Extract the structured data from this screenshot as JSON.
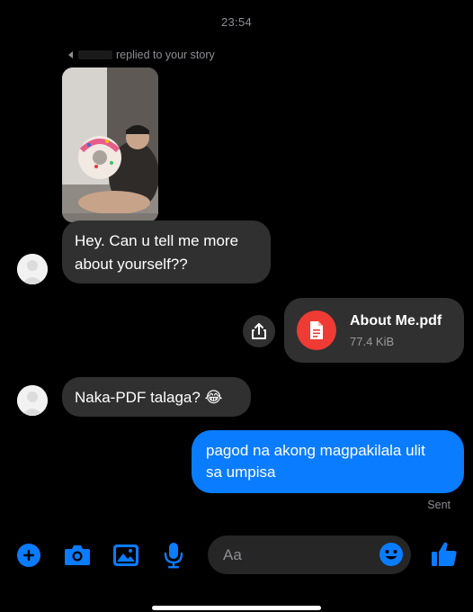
{
  "status": {
    "time": "23:54"
  },
  "story_reply": {
    "text": "replied to your story"
  },
  "messages": {
    "incoming_1": {
      "lines": [
        "Hey. Can u tell me more",
        "about yourself??"
      ]
    },
    "attachment": {
      "file_name": "About Me.pdf",
      "file_size": "77.4 KiB"
    },
    "incoming_2": {
      "text": "Naka-PDF talaga? 😂"
    },
    "outgoing_1": {
      "lines": [
        "pagod na akong magpakilala ulit",
        "sa umpisa"
      ]
    },
    "status_label": "Sent"
  },
  "composer": {
    "placeholder": "Aa",
    "icons": [
      "plus-icon",
      "camera-icon",
      "image-icon",
      "microphone-icon",
      "emoji-icon",
      "thumbs-up-icon"
    ]
  },
  "colors": {
    "accent": "#0a7cff",
    "incoming_bubble": "#303030",
    "pdf_red": "#ee3b34",
    "background": "#000000"
  }
}
